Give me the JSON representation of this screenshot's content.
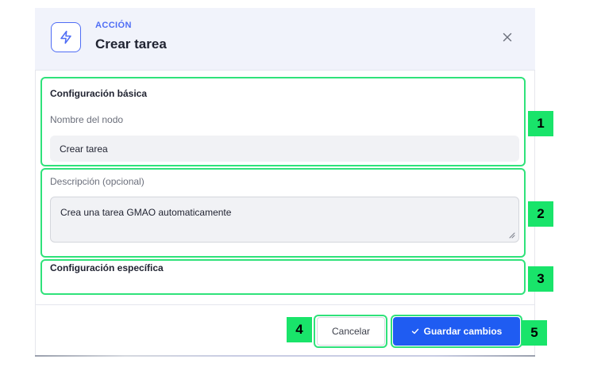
{
  "header": {
    "kicker": "ACCIÓN",
    "title": "Crear tarea",
    "icon": "lightning-bolt-icon",
    "close_icon": "close-icon"
  },
  "basic_config": {
    "section_title": "Configuración básica",
    "node_name_label": "Nombre del nodo",
    "node_name_value": "Crear tarea"
  },
  "description": {
    "label": "Descripción (opcional)",
    "value": "Crea una tarea GMAO automaticamente"
  },
  "specific_config": {
    "section_title": "Configuración específica"
  },
  "footer": {
    "cancel_label": "Cancelar",
    "save_label": "Guardar cambios",
    "save_icon": "check-icon"
  },
  "annotations": {
    "badges": [
      "1",
      "2",
      "3",
      "4",
      "5"
    ]
  },
  "colors": {
    "accent": "#4f6df5",
    "primary_button": "#1f5cf2",
    "header_bg": "#f1f3fb",
    "annotation_green": "#19e46a"
  }
}
